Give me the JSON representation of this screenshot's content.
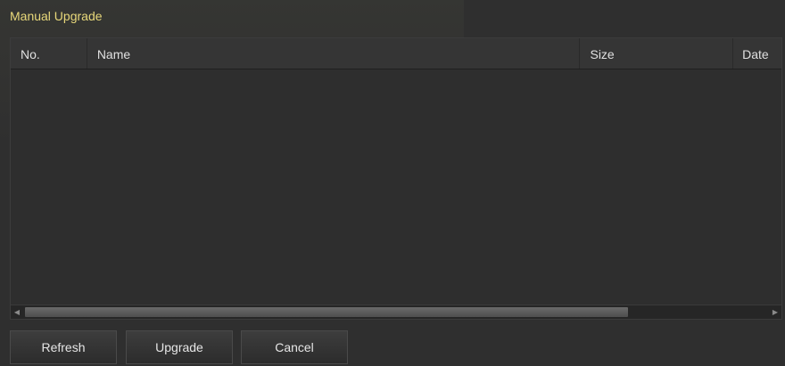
{
  "dialog": {
    "title": "Manual Upgrade"
  },
  "table": {
    "columns": [
      "No.",
      "Name",
      "Size",
      "Date"
    ],
    "rows": []
  },
  "scrollbar": {
    "left_arrow_icon": "triangle-left",
    "right_arrow_icon": "triangle-right"
  },
  "buttons": {
    "refresh": "Refresh",
    "upgrade": "Upgrade",
    "cancel": "Cancel"
  },
  "colors": {
    "title": "#e8d87a",
    "background": "#2f2f2f",
    "text": "#e0e0e0"
  }
}
